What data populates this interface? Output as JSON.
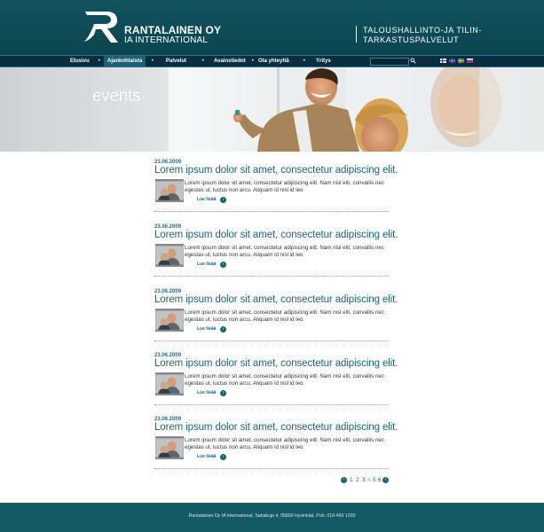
{
  "brand": {
    "name": "RANTALAINEN OY",
    "subtitle": "IA INTERNATIONAL",
    "tagline_line1": "TALOUSHALLINTO-JA TILIN-",
    "tagline_line2": "TARKASTUSPALVELUT"
  },
  "nav": {
    "items": [
      {
        "label": "Etusivu",
        "active": false
      },
      {
        "label": "Ajankohtaista",
        "active": true
      },
      {
        "label": "Palvelut",
        "active": false
      },
      {
        "label": "Avainstiedot",
        "active": false
      },
      {
        "label": "Ota yhteyttä",
        "active": false
      },
      {
        "label": "Yritys",
        "active": false
      }
    ],
    "search_placeholder": "",
    "languages": [
      "fi-flag",
      "uk-flag",
      "se-flag",
      "ru-flag"
    ]
  },
  "hero": {
    "title": "events"
  },
  "events": [
    {
      "date": "23.06.2009",
      "title": "Lorem ipsum dolor sit amet, consectetur adipiscing elit.",
      "text": "Lorem ipsum dolor sit amet, consectetur adipiscing elit. Nam nisl elit, convallis nec egestas ut, luctus non arcu. Aliquam id nisl id leo",
      "readmore": "Lue lisää"
    },
    {
      "date": "23.06.2009",
      "title": "Lorem ipsum dolor sit amet, consectetur adipiscing elit.",
      "text": "Lorem ipsum dolor sit amet, consectetur adipiscing elit. Nam nisl elit, convallis nec egestas ut, luctus non arcu. Aliquam id nisl id leo",
      "readmore": "Lue lisää"
    },
    {
      "date": "23.06.2009",
      "title": "Lorem ipsum dolor sit amet, consectetur adipiscing elit.",
      "text": "Lorem ipsum dolor sit amet, consectetur adipiscing elit. Nam nisl elit, convallis nec egestas ut, luctus non arcu. Aliquam id nisl id leo",
      "readmore": "Lue lisää"
    },
    {
      "date": "23.06.2009",
      "title": "Lorem ipsum dolor sit amet, consectetur adipiscing elit.",
      "text": "Lorem ipsum dolor sit amet, consectetur adipiscing elit. Nam nisl elit, convallis nec egestas ut, luctus non arcu. Aliquam id nisl id leo",
      "readmore": "Lue lisää"
    },
    {
      "date": "23.06.2009",
      "title": "Lorem ipsum dolor sit amet, consectetur adipiscing elit.",
      "text": "Lorem ipsum dolor sit amet, consectetur adipiscing elit. Nam nisl elit, convallis nec egestas ut, luctus non arcu. Aliquam id nisl id leo",
      "readmore": "Lue lisää"
    }
  ],
  "pagination": {
    "pages": [
      "1",
      "2",
      "3",
      "4",
      "5",
      "6"
    ],
    "current": "4"
  },
  "footer": {
    "text": "Rantalainen Oy IA International, Sahakuja 4, 05800 Hyvinkää. Puh. 019-460 1200"
  },
  "colors": {
    "header": "#11535f",
    "nav": "#0a2e40",
    "accent": "#1d6378",
    "footer": "#135a66"
  }
}
